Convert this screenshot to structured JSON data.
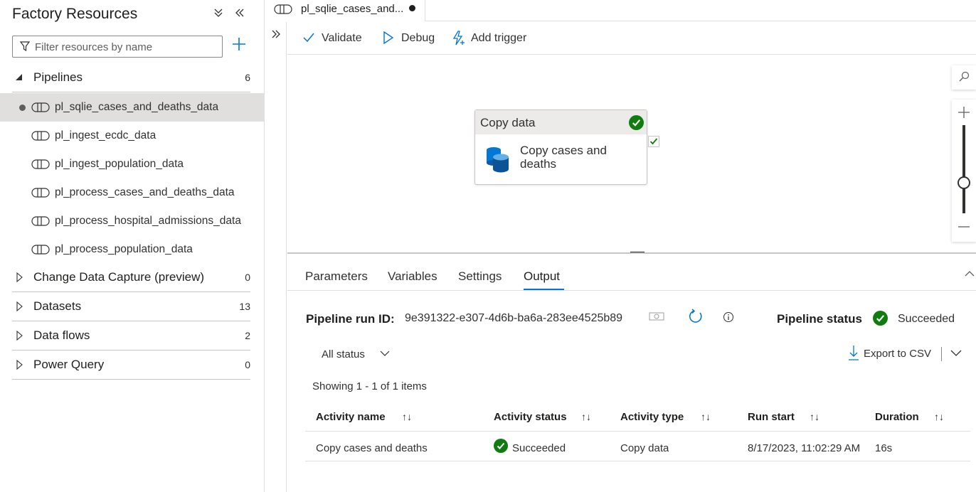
{
  "left_panel": {
    "title": "Factory Resources",
    "filter_placeholder": "Filter resources by name",
    "sections": [
      {
        "label": "Pipelines",
        "count": "6"
      },
      {
        "label": "Change Data Capture (preview)",
        "count": "0"
      },
      {
        "label": "Datasets",
        "count": "13"
      },
      {
        "label": "Data flows",
        "count": "2"
      },
      {
        "label": "Power Query",
        "count": "0"
      }
    ],
    "pipelines": [
      "pl_sqlie_cases_and_deaths_data",
      "pl_ingest_ecdc_data",
      "pl_ingest_population_data",
      "pl_process_cases_and_deaths_data",
      "pl_process_hospital_admissions_data",
      "pl_process_population_data"
    ]
  },
  "tab": {
    "label": "pl_sqlie_cases_and..."
  },
  "toolbar": {
    "validate": "Validate",
    "debug": "Debug",
    "add_trigger": "Add trigger"
  },
  "activity": {
    "type": "Copy data",
    "name": "Copy cases and deaths"
  },
  "bottom_panel": {
    "tabs": [
      "Parameters",
      "Variables",
      "Settings",
      "Output"
    ],
    "active_tab": "Output",
    "run_id_label": "Pipeline run ID:",
    "run_id": "9e391322-e307-4d6b-ba6a-283ee4525b89",
    "status_label": "Pipeline status",
    "status_value": "Succeeded",
    "filter_label": "All status",
    "export_label": "Export to CSV",
    "showing": "Showing 1 - 1 of 1 items",
    "columns": [
      "Activity name",
      "Activity status",
      "Activity type",
      "Run start",
      "Duration"
    ],
    "rows": [
      {
        "name": "Copy cases and deaths",
        "status": "Succeeded",
        "type": "Copy data",
        "run_start": "8/17/2023, 11:02:29 AM",
        "duration": "16s"
      }
    ]
  },
  "colors": {
    "accent": "#0078d4",
    "success": "#107c10",
    "selected_bg": "#e1dfdd"
  }
}
